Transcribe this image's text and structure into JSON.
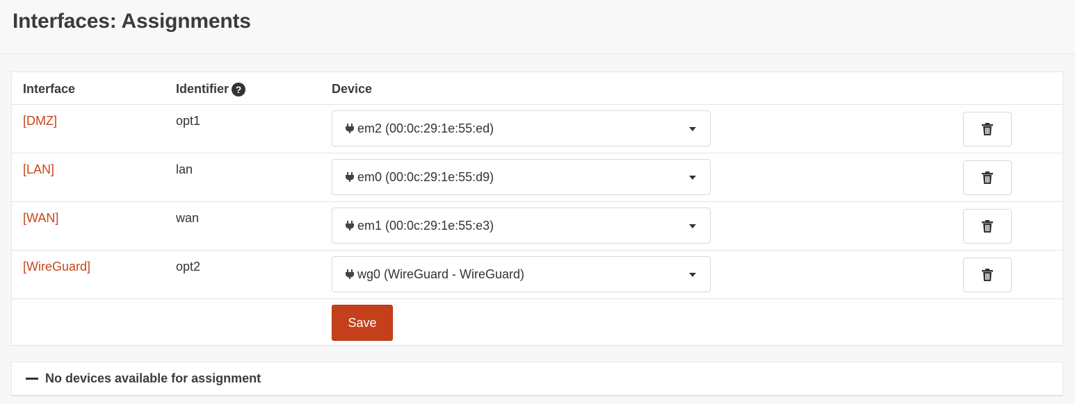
{
  "page": {
    "title": "Interfaces: Assignments"
  },
  "table": {
    "headers": {
      "interface": "Interface",
      "identifier": "Identifier",
      "identifier_help_icon": "?",
      "device": "Device"
    },
    "rows": [
      {
        "interface": "[DMZ]",
        "identifier": "opt1",
        "device": "em2 (00:0c:29:1e:55:ed)"
      },
      {
        "interface": "[LAN]",
        "identifier": "lan",
        "device": "em0 (00:0c:29:1e:55:d9)"
      },
      {
        "interface": "[WAN]",
        "identifier": "wan",
        "device": "em1 (00:0c:29:1e:55:e3)"
      },
      {
        "interface": "[WireGuard]",
        "identifier": "opt2",
        "device": "wg0 (WireGuard - WireGuard)"
      }
    ],
    "save_label": "Save"
  },
  "unassigned": {
    "label": "No devices available for assignment"
  },
  "colors": {
    "link": "#c6461b",
    "save_button": "#c4401a"
  },
  "icons": {
    "row_device": "plug-icon",
    "row_delete": "trash-icon",
    "help": "question-circle-icon",
    "collapse": "minus-icon"
  }
}
